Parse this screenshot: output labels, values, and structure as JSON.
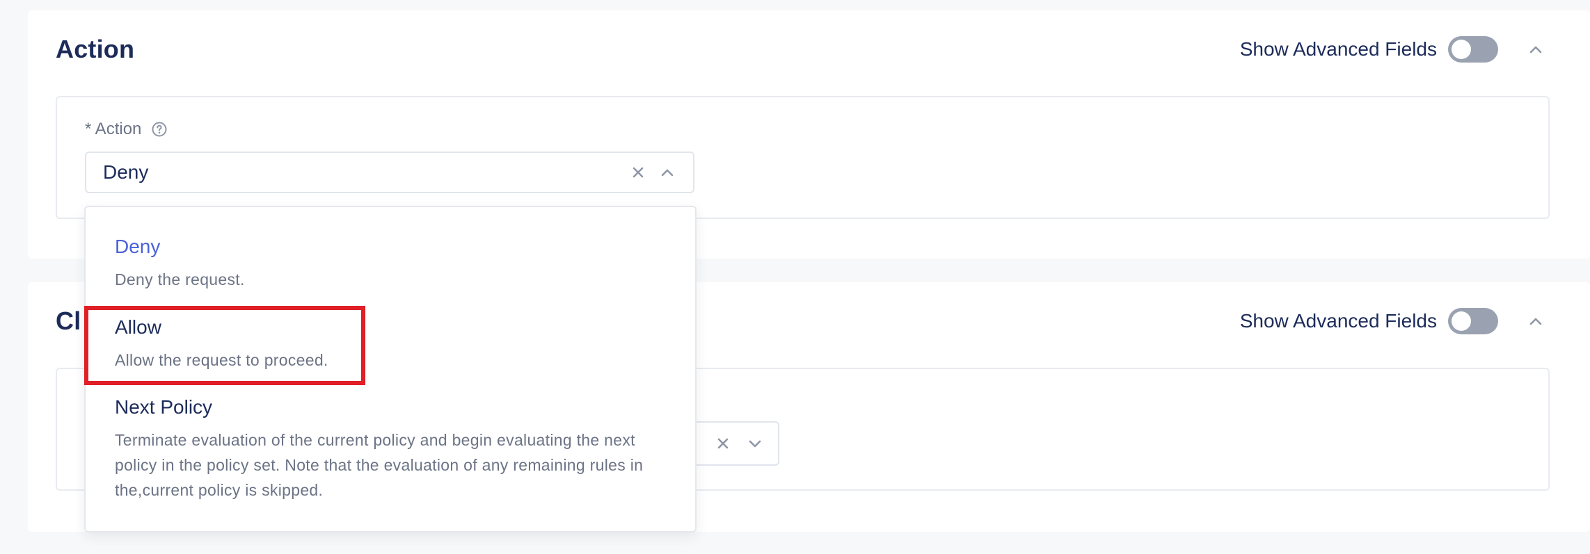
{
  "sections": [
    {
      "title": "Action",
      "advanced_label": "Show Advanced Fields",
      "advanced_enabled": false,
      "field": {
        "label": "* Action",
        "value": "Deny"
      }
    },
    {
      "title": "Cl",
      "advanced_label": "Show Advanced Fields",
      "advanced_enabled": false
    }
  ],
  "dropdown": {
    "options": [
      {
        "title": "Deny",
        "description": "Deny the request.",
        "selected": true
      },
      {
        "title": "Allow",
        "description": "Allow the request to proceed.",
        "selected": false
      },
      {
        "title": "Next Policy",
        "description": "Terminate evaluation of the current policy and begin evaluating the next policy in the policy set. Note that the evaluation of any remaining rules in the,current policy is skipped.",
        "selected": false
      }
    ]
  },
  "colors": {
    "accent": "#4a62d8",
    "highlight": "#e01f26",
    "toggle_off": "#9aa2b1",
    "text_primary": "#1c2b5a",
    "text_secondary": "#6b7385"
  },
  "icons": {
    "help": "question-circle-icon",
    "clear": "close-icon",
    "caret_up": "chevron-up-icon",
    "caret_down": "chevron-down-icon"
  }
}
